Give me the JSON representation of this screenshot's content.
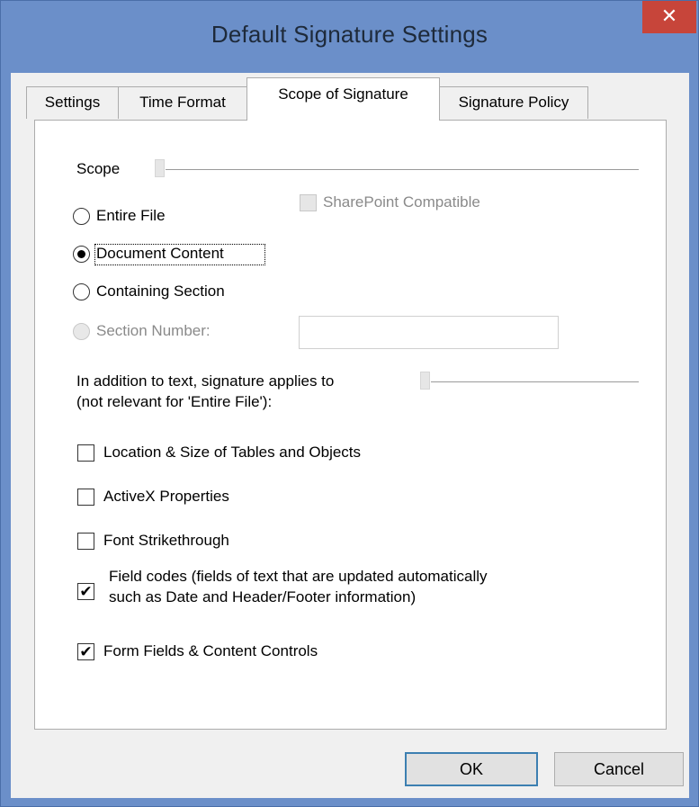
{
  "window": {
    "title": "Default Signature Settings",
    "close_glyph": "✕"
  },
  "tabs": [
    {
      "label": "Settings",
      "active": false
    },
    {
      "label": "Time Format",
      "active": false
    },
    {
      "label": "Scope of Signature",
      "active": true
    },
    {
      "label": "Signature Policy",
      "active": false
    }
  ],
  "scope": {
    "group_label": "Scope",
    "options": [
      {
        "label": "Entire File",
        "checked": false,
        "disabled": false
      },
      {
        "label": "Document Content",
        "checked": true,
        "disabled": false
      },
      {
        "label": "Containing Section",
        "checked": false,
        "disabled": false
      },
      {
        "label": "Section Number:",
        "checked": false,
        "disabled": true
      }
    ],
    "sharepoint_label": "SharePoint Compatible",
    "sharepoint_checked": false,
    "section_number_value": ""
  },
  "applies": {
    "group_label_line1": "In addition to text, signature applies to",
    "group_label_line2": "(not relevant for 'Entire File'):",
    "items": [
      {
        "label": "Location & Size of Tables and Objects",
        "checked": false
      },
      {
        "label": "ActiveX  Properties",
        "checked": false
      },
      {
        "label": "Font Strikethrough",
        "checked": false
      },
      {
        "label_line1": "Field codes (fields of text that are updated automatically",
        "label_line2": "such as Date and Header/Footer information)",
        "checked": true
      },
      {
        "label": "Form Fields & Content Controls",
        "checked": true
      }
    ]
  },
  "check_glyph": "✔",
  "buttons": {
    "ok": "OK",
    "cancel": "Cancel"
  },
  "colors": {
    "titlebar": "#6b8fc9",
    "close_button": "#c7453a",
    "dialog_bg": "#f0f0f0",
    "panel_bg": "#ffffff",
    "default_button_border": "#3c7fb1"
  }
}
